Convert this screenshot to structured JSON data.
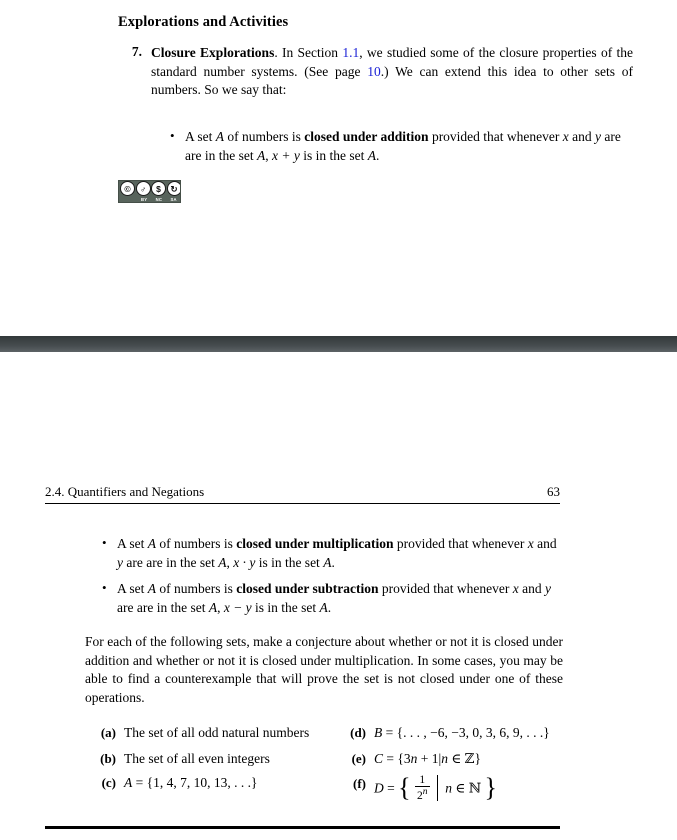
{
  "document": {
    "page_one": {
      "section_heading": "Explorations and Activities",
      "exercise": {
        "number": "7.",
        "title": "Closure Explorations",
        "text_a": ". In Section ",
        "link_section": "1.1",
        "text_b": ", we studied some of the closure properties of the standard number systems.  (See page ",
        "link_page": "10",
        "text_c": ".)  We can extend this idea to other sets of numbers. So we say that:"
      },
      "bullets": [
        {
          "lead": "A set ",
          "var1": "A",
          "mid1": " of numbers is ",
          "bold": "closed under addition",
          "mid2": " provided that whenever ",
          "var2": "x",
          "mid3": " and ",
          "var3": "y",
          "mid4": " are are in the set ",
          "var4": "A",
          "mid5": ", ",
          "expr": "x + y",
          "tail": " is in the set ",
          "var5": "A",
          "period": "."
        }
      ],
      "license_badge": {
        "mark": "CC",
        "icons": [
          "cc-icon",
          "by-person-icon",
          "nc-dollar-slash-icon",
          "sa-share-alike-icon"
        ],
        "labels": [
          "BY",
          "NC",
          "SA"
        ]
      }
    },
    "page_two": {
      "running_header": {
        "title": "2.4. Quantifiers and Negations",
        "page_number": "63"
      },
      "bullets": [
        {
          "lead": "A set ",
          "var1": "A",
          "mid1": " of numbers is ",
          "bold": "closed under multiplication",
          "mid2": " provided that whenever ",
          "var2": "x",
          "mid3": " and ",
          "var3": "y",
          "mid4": " are are in the set ",
          "var4": "A",
          "mid5": ", ",
          "expr": "x · y",
          "tail": " is in the set ",
          "var5": "A",
          "period": "."
        },
        {
          "lead": "A set ",
          "var1": "A",
          "mid1": " of numbers is ",
          "bold": "closed under subtraction",
          "mid2": " provided that whenever ",
          "var2": "x",
          "mid3": " and ",
          "var3": "y",
          "mid4": " are are in the set ",
          "var4": "A",
          "mid5": ", ",
          "expr": "x − y",
          "tail": " is in the set ",
          "var5": "A",
          "period": "."
        }
      ],
      "paragraph": "For each of the following sets, make a conjecture about whether or not it is closed under addition and whether or not it is closed under multiplication. In some cases, you may be able to find a counterexample that will prove the set is not closed under one of these operations.",
      "enumerated": {
        "left": [
          {
            "label": "(a)",
            "text": "The set of all odd natural numbers"
          },
          {
            "label": "(b)",
            "text": "The set of all even integers"
          },
          {
            "label": "(c)",
            "text": "A = {1, 4, 7, 10, 13, . . .}",
            "var": "A",
            "body": " = {1, 4, 7, 10, 13, . . .}"
          }
        ],
        "right": [
          {
            "label": "(d)",
            "var": "B",
            "body": " = {. . . , −6, −3, 0, 3, 6, 9, . . .}"
          },
          {
            "label": "(e)",
            "var": "C",
            "body": " = {3n + 1 | n ∈ ℤ}",
            "expr_pre": " = {3",
            "nvar": "n",
            "expr_mid": " + 1|",
            "nvar2": "n",
            "expr_post": " ∈ ℤ}"
          },
          {
            "label": "(f)",
            "var": "D",
            "numerator": "1",
            "denominator": "2",
            "denominator_exp": "n",
            "condition_var": "n",
            "condition": " ∈ ℕ"
          }
        ]
      }
    }
  },
  "colors": {
    "link": "#1b21d6",
    "text": "#000000",
    "page_background": "#ffffff",
    "separator_band_top": "#32383a",
    "separator_band_bottom": "#5d6366",
    "cc_badge_background": "#58645c"
  }
}
